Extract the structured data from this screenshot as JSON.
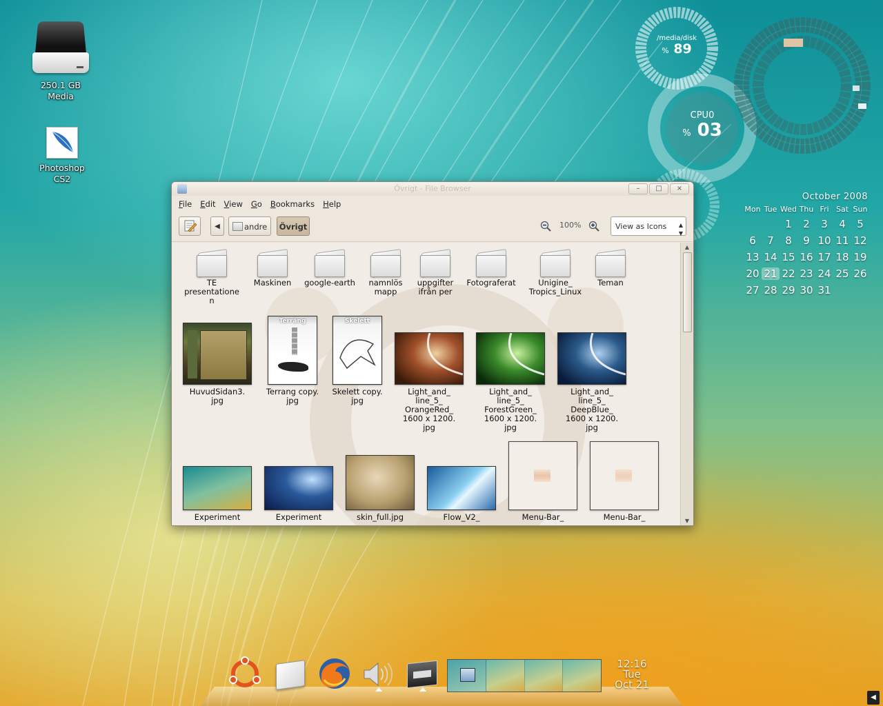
{
  "desktop": {
    "icons": [
      {
        "label_line1": "250.1 GB",
        "label_line2": "Media",
        "icon": "hard-drive-icon"
      },
      {
        "label_line1": "Photoshop",
        "label_line2": "CS2",
        "icon": "photoshop-feather-icon"
      }
    ]
  },
  "conky": {
    "disk": {
      "path": "/media/disk",
      "percent_sign": "%",
      "value": "89",
      "percent": 89
    },
    "cpu": {
      "name": "CPU0",
      "percent_sign": "%",
      "value": "03",
      "percent": 3
    }
  },
  "calendar": {
    "month": "October 2008",
    "weekdays": [
      "Mon",
      "Tue",
      "Wed",
      "Thu",
      "Fri",
      "Sat",
      "Sun"
    ],
    "days": [
      "",
      "",
      "1",
      "2",
      "3",
      "4",
      "5",
      "6",
      "7",
      "8",
      "9",
      "10",
      "11",
      "12",
      "13",
      "14",
      "15",
      "16",
      "17",
      "18",
      "19",
      "20",
      "21",
      "22",
      "23",
      "24",
      "25",
      "26",
      "27",
      "28",
      "29",
      "30",
      "31",
      "",
      "",
      "",
      ""
    ],
    "today": "21"
  },
  "window": {
    "title": "Övrigt - File Browser",
    "controls": {
      "minimize": "–",
      "maximize": "□",
      "close": "×"
    },
    "menu": [
      "File",
      "Edit",
      "View",
      "Go",
      "Bookmarks",
      "Help"
    ],
    "toolbar": {
      "back": "◀",
      "path": [
        "andre",
        "Övrigt"
      ],
      "zoom": "100%",
      "view_mode": "View as Icons"
    },
    "items": [
      {
        "label": "TE\npresentatione\nn",
        "kind": "folder"
      },
      {
        "label": "Maskinen",
        "kind": "folder"
      },
      {
        "label": "google-earth",
        "kind": "folder"
      },
      {
        "label": "namnlös\nmapp",
        "kind": "folder"
      },
      {
        "label": "uppgifter\nifrån per",
        "kind": "folder"
      },
      {
        "label": "Fotograferat",
        "kind": "folder"
      },
      {
        "label": "Unigine_\nTropics_Linux",
        "kind": "folder"
      },
      {
        "label": "Teman",
        "kind": "folder"
      },
      {
        "label": "HuvudSidan3.\njpg",
        "kind": "image"
      },
      {
        "label": "Terrang copy.\njpg",
        "kind": "image",
        "caption": "Terräng"
      },
      {
        "label": "Skelett copy.\njpg",
        "kind": "image",
        "caption": "Skelett"
      },
      {
        "label": "Light_and_\nline_5_\nOrangeRed_\n1600 x 1200.\njpg",
        "kind": "image"
      },
      {
        "label": "Light_and_\nline_5_\nForestGreen_\n1600 x 1200.\njpg",
        "kind": "image"
      },
      {
        "label": "Light_and_\nline_5_\nDeepBlue_\n1600 x 1200.\njpg",
        "kind": "image"
      },
      {
        "label": "Experiment",
        "kind": "image"
      },
      {
        "label": "Experiment",
        "kind": "image"
      },
      {
        "label": "skin_full.jpg",
        "kind": "image"
      },
      {
        "label": "Flow_V2_",
        "kind": "image"
      },
      {
        "label": "Menu-Bar_",
        "kind": "image"
      },
      {
        "label": "Menu-Bar_",
        "kind": "image"
      }
    ]
  },
  "dock": {
    "apps": [
      "ubuntu-icon",
      "folder-icon",
      "firefox-icon",
      "volume-icon",
      "window-icon"
    ],
    "clock": {
      "time": "12:16",
      "day": "Tue",
      "date": "Oct 21"
    },
    "workspaces": 4,
    "current_workspace": 1
  },
  "colors": {
    "accent": "#c9b79e",
    "window_bg": "#ede7de"
  }
}
